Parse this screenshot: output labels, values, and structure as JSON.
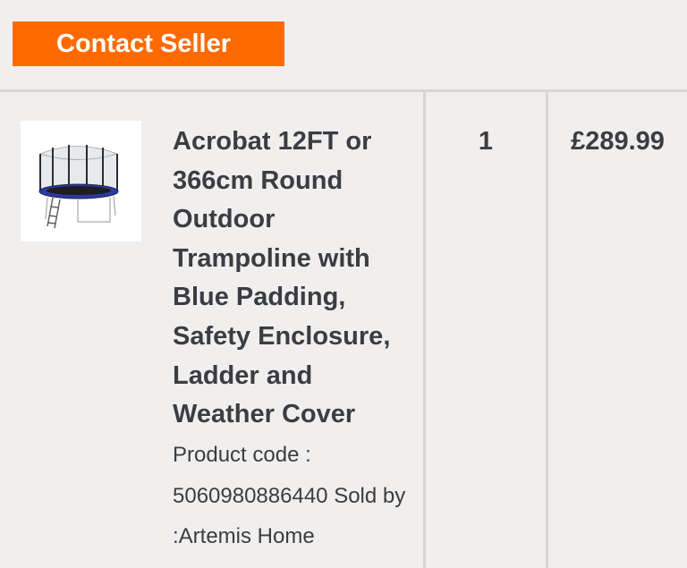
{
  "header": {
    "contact_seller_label": "Contact Seller",
    "accent_color": "#ff6a00"
  },
  "order_item": {
    "image_icon": "trampoline-product-image",
    "title": "Acrobat 12FT or 366cm Round Outdoor Trampoline with Blue Padding, Safety Enclosure, Ladder and Weather Cover",
    "meta": "Product code : 5060980886440 Sold by :Artemis Home",
    "quantity": "1",
    "price": "£289.99"
  }
}
